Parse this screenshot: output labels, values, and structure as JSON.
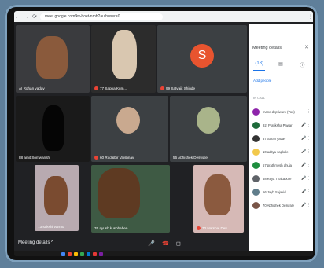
{
  "browser": {
    "url": "meet.google.com/kv-hoet-nmb?authuser=0",
    "back": "←",
    "forward": "→",
    "reload": "⟳",
    "lock": "🔒",
    "menu": "⋮"
  },
  "tiles": [
    {
      "name": "AI Rohan yadav"
    },
    {
      "name": "77 Sapna Kum..."
    },
    {
      "name": "99 Satyajit Shinde",
      "initial": "S"
    },
    {
      "name": "88 amit Somwanshi"
    },
    {
      "name": "60 Rudalbir Vaishnav"
    },
    {
      "name": "56 Abhishek Deswale"
    },
    {
      "name": "73 sakshi varmo"
    },
    {
      "name": "76 ayush kushbaben"
    },
    {
      "name": "70 Harshal Dev..."
    }
  ],
  "controls": {
    "meeting_details": "Meeting details",
    "caret": "^",
    "mic": "🎤",
    "end_call": "☎",
    "camera": "◻",
    "present_now": "Present now"
  },
  "panel": {
    "title": "Meeting details",
    "close": "✕",
    "tab_people": "(18)",
    "tab_chat": "▤",
    "tab_info": "ⓘ",
    "add_people": "Add people",
    "section": "IN CALL",
    "participants": [
      {
        "name": "mane deptiwaro (You)",
        "color": "#8e24aa"
      },
      {
        "name": "92_Pratiksha Pawar",
        "color": "#1e6b3a"
      },
      {
        "name": "37 Saran yadav",
        "color": "#333"
      },
      {
        "name": "10 aditya sapkale",
        "color": "#f2c94c"
      },
      {
        "name": "57 prathmesh ahuja",
        "color": "#1e8e3e"
      },
      {
        "name": "58 Keya Thakapure",
        "color": "#5f6368"
      },
      {
        "name": "56 Jayh Sajakid",
        "color": "#607d8b"
      },
      {
        "name": "70 Abhishek Deswale",
        "color": "#795548"
      }
    ]
  }
}
